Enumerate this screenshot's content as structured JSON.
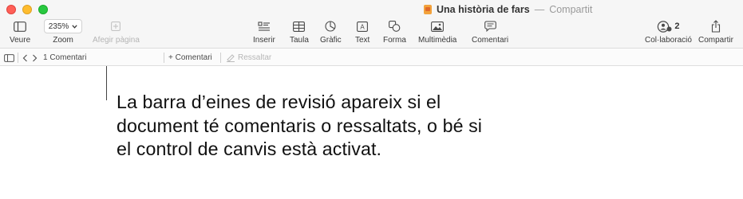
{
  "window": {
    "title": "Una història de fars",
    "title_separator": "—",
    "status": "Compartit"
  },
  "toolbar": {
    "view_label": "Veure",
    "zoom_label": "Zoom",
    "zoom_value": "235%",
    "add_page_label": "Afegir pàgina",
    "insert_label": "Inserir",
    "table_label": "Taula",
    "chart_label": "Gràfic",
    "text_label": "Text",
    "shape_label": "Forma",
    "media_label": "Multimèdia",
    "comment_label": "Comentari",
    "collab_label": "Col·laboració",
    "collab_count": "2",
    "share_label": "Compartir"
  },
  "review_bar": {
    "comment_count": "1 Comentari",
    "add_comment": "+ Comentari",
    "highlight": "Ressaltar"
  },
  "callout": {
    "text": "La barra d’eines de revisió apareix si el document té comentaris o ressaltats, o bé si el control de canvis està activat."
  },
  "icons": {
    "view": "sidebar-icon",
    "add_page": "plus-square-icon",
    "insert": "list-insert-icon",
    "table": "table-icon",
    "chart": "pie-chart-icon",
    "text": "text-box-icon",
    "shape": "shape-icon",
    "media": "photo-icon",
    "comment": "speech-bubble-icon",
    "collab": "people-icon",
    "share": "share-icon"
  },
  "colors": {
    "close": "#ff5f57",
    "minimize": "#febc2e",
    "maximize": "#28c840",
    "doc_icon": "#f2a23c"
  }
}
